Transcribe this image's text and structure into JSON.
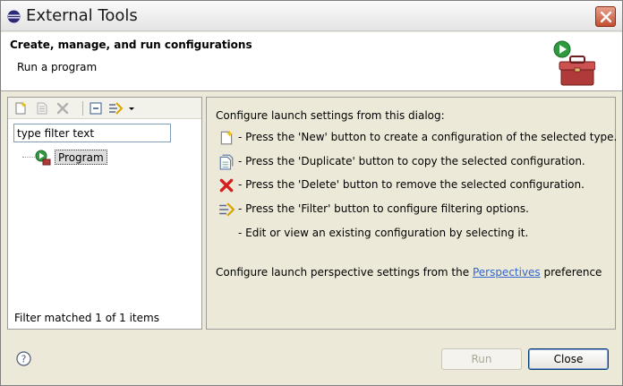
{
  "window": {
    "title": "External Tools"
  },
  "header": {
    "title": "Create, manage, and run configurations",
    "subtitle": "Run a program"
  },
  "left": {
    "filter_placeholder": "type filter text",
    "filter_value": "type filter text",
    "tree_item": "Program",
    "status": "Filter matched 1 of 1 items"
  },
  "right": {
    "intro": "Configure launch settings from this dialog:",
    "rows": [
      {
        "icon": "new-config-icon",
        "text": "- Press the 'New' button to create a configuration of the selected type."
      },
      {
        "icon": "duplicate-icon",
        "text": "- Press the 'Duplicate' button to copy the selected configuration."
      },
      {
        "icon": "delete-icon",
        "text": "- Press the 'Delete' button to remove the selected configuration."
      },
      {
        "icon": "filter-icon",
        "text": "- Press the 'Filter' button to configure filtering options."
      },
      {
        "icon": "",
        "text": "- Edit or view an existing configuration by selecting it."
      }
    ],
    "persp_before": "Configure launch perspective settings from the ",
    "persp_link": "Perspectives",
    "persp_after": " preference"
  },
  "buttons": {
    "run": "Run",
    "close": "Close"
  },
  "colors": {
    "link": "#3366cc",
    "close_red": "#c44e30",
    "delete_red": "#d42020"
  }
}
